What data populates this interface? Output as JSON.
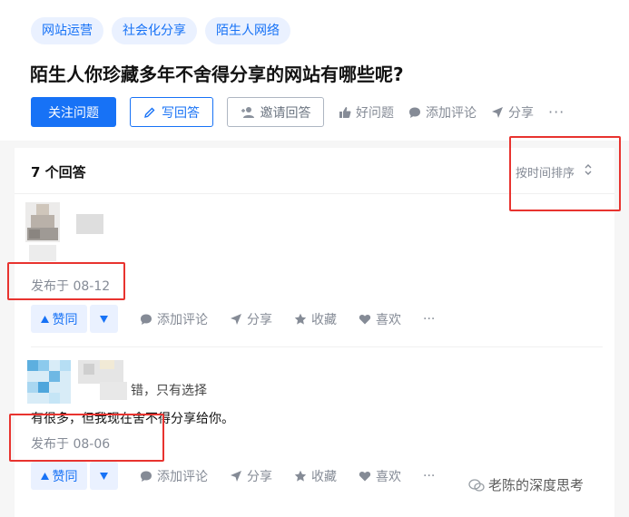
{
  "tags": [
    "网站运营",
    "社会化分享",
    "陌生人网络"
  ],
  "question_title": "陌生人你珍藏多年不舍得分享的网站有哪些呢?",
  "actions": {
    "follow": "关注问题",
    "write_answer": "写回答",
    "invite": "邀请回答",
    "good_question": "好问题",
    "add_comment": "添加评论",
    "share": "分享",
    "more": "···"
  },
  "answers_header": {
    "count": "7 个回答",
    "sort": "按时间排序"
  },
  "answers": [
    {
      "published": "发布于 08-12",
      "bar": {
        "upvote": "赞同",
        "comment": "添加评论",
        "share": "分享",
        "collect": "收藏",
        "like": "喜欢",
        "more": "···"
      }
    },
    {
      "snippet": "错，只有选择",
      "content": "有很多，但我现在舍不得分享给你。",
      "published": "发布于 08-06",
      "bar": {
        "upvote": "赞同",
        "comment": "添加评论",
        "share": "分享",
        "collect": "收藏",
        "like": "喜欢",
        "more": "···"
      }
    }
  ],
  "watermark": "老陈的深度思考",
  "colors": {
    "brand": "#1772f6",
    "highlight_box": "#e8332f"
  }
}
